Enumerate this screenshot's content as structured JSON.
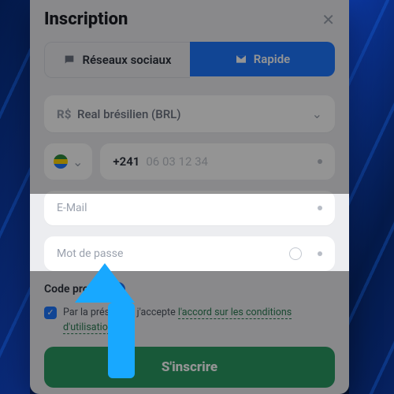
{
  "header": {
    "title": "Inscription"
  },
  "tabs": {
    "social": "Réseaux sociaux",
    "quick": "Rapide"
  },
  "currency": {
    "symbol": "R$",
    "label": "Real brésilien (BRL)"
  },
  "phone": {
    "code": "+241",
    "placeholder": "06 03 12 34"
  },
  "email": {
    "placeholder": "E-Mail"
  },
  "password": {
    "placeholder": "Mot de passe"
  },
  "promo": {
    "label": "Code promo"
  },
  "terms": {
    "prefix": "Par la présent et j'accepte ",
    "link": "l'accord sur les conditions d'utilisation"
  },
  "submit": {
    "label": "S'inscrire"
  }
}
